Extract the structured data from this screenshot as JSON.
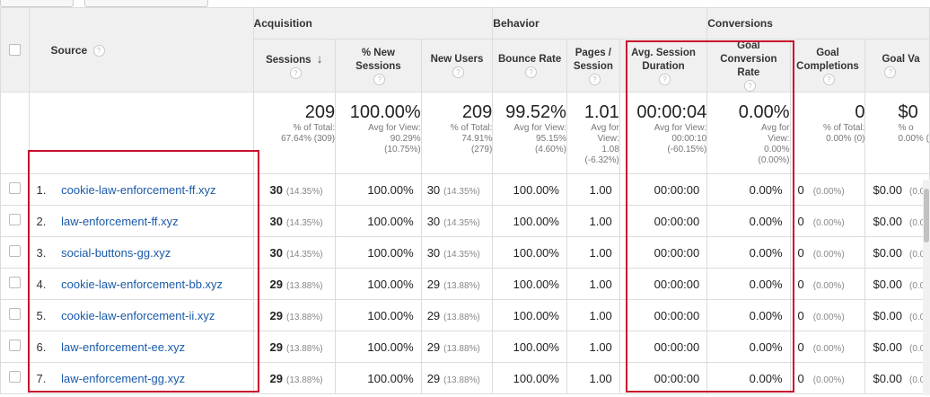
{
  "groups": {
    "acquisition": "Acquisition",
    "behavior": "Behavior",
    "conversions": "Conversions"
  },
  "columns": {
    "source": "Source",
    "sessions": "Sessions",
    "new_sessions": "% New Sessions",
    "new_users": "New Users",
    "bounce_rate": "Bounce Rate",
    "pages_session": "Pages / Session",
    "avg_duration": "Avg. Session Duration",
    "goal_conv_rate": "Goal Conversion Rate",
    "goal_completions": "Goal Completions",
    "goal_value": "Goal Va"
  },
  "totals": {
    "sessions": {
      "value": "209",
      "sub1": "% of Total:",
      "sub2": "67.64% (309)"
    },
    "new_sessions": {
      "value": "100.00%",
      "sub1": "Avg for View:",
      "sub2": "90.29%",
      "sub3": "(10.75%)"
    },
    "new_users": {
      "value": "209",
      "sub1": "% of Total:",
      "sub2": "74.91%",
      "sub3": "(279)"
    },
    "bounce_rate": {
      "value": "99.52%",
      "sub1": "Avg for View:",
      "sub2": "95.15%",
      "sub3": "(4.60%)"
    },
    "pages_session": {
      "value": "1.01",
      "sub1": "Avg for",
      "sub2": "View:",
      "sub3": "1.08",
      "sub4": "(-6.32%)"
    },
    "avg_duration": {
      "value": "00:00:04",
      "sub1": "Avg for View:",
      "sub2": "00:00:10",
      "sub3": "(-60.15%)"
    },
    "goal_conv_rate": {
      "value": "0.00%",
      "sub1": "Avg for",
      "sub2": "View:",
      "sub3": "0.00%",
      "sub4": "(0.00%)"
    },
    "goal_completions": {
      "value": "0",
      "sub1": "% of Total:",
      "sub2": "0.00% (0)"
    },
    "goal_value": {
      "value": "$0",
      "sub1": "% o",
      "sub2": "0.00% ("
    }
  },
  "rows": [
    {
      "idx": "1.",
      "source": "cookie-law-enforcement-ff.xyz",
      "sessions": "30",
      "sessions_pct": "(14.35%)",
      "new_sessions": "100.00%",
      "new_users": "30",
      "new_users_pct": "(14.35%)",
      "bounce": "100.00%",
      "pages": "1.00",
      "duration": "00:00:00",
      "conv": "0.00%",
      "completions": "0",
      "completions_pct": "(0.00%)",
      "value": "$0.00",
      "value_pct": "(0.0"
    },
    {
      "idx": "2.",
      "source": "law-enforcement-ff.xyz",
      "sessions": "30",
      "sessions_pct": "(14.35%)",
      "new_sessions": "100.00%",
      "new_users": "30",
      "new_users_pct": "(14.35%)",
      "bounce": "100.00%",
      "pages": "1.00",
      "duration": "00:00:00",
      "conv": "0.00%",
      "completions": "0",
      "completions_pct": "(0.00%)",
      "value": "$0.00",
      "value_pct": "(0.0"
    },
    {
      "idx": "3.",
      "source": "social-buttons-gg.xyz",
      "sessions": "30",
      "sessions_pct": "(14.35%)",
      "new_sessions": "100.00%",
      "new_users": "30",
      "new_users_pct": "(14.35%)",
      "bounce": "100.00%",
      "pages": "1.00",
      "duration": "00:00:00",
      "conv": "0.00%",
      "completions": "0",
      "completions_pct": "(0.00%)",
      "value": "$0.00",
      "value_pct": "(0.0"
    },
    {
      "idx": "4.",
      "source": "cookie-law-enforcement-bb.xyz",
      "sessions": "29",
      "sessions_pct": "(13.88%)",
      "new_sessions": "100.00%",
      "new_users": "29",
      "new_users_pct": "(13.88%)",
      "bounce": "100.00%",
      "pages": "1.00",
      "duration": "00:00:00",
      "conv": "0.00%",
      "completions": "0",
      "completions_pct": "(0.00%)",
      "value": "$0.00",
      "value_pct": "(0.0"
    },
    {
      "idx": "5.",
      "source": "cookie-law-enforcement-ii.xyz",
      "sessions": "29",
      "sessions_pct": "(13.88%)",
      "new_sessions": "100.00%",
      "new_users": "29",
      "new_users_pct": "(13.88%)",
      "bounce": "100.00%",
      "pages": "1.00",
      "duration": "00:00:00",
      "conv": "0.00%",
      "completions": "0",
      "completions_pct": "(0.00%)",
      "value": "$0.00",
      "value_pct": "(0.0"
    },
    {
      "idx": "6.",
      "source": "law-enforcement-ee.xyz",
      "sessions": "29",
      "sessions_pct": "(13.88%)",
      "new_sessions": "100.00%",
      "new_users": "29",
      "new_users_pct": "(13.88%)",
      "bounce": "100.00%",
      "pages": "1.00",
      "duration": "00:00:00",
      "conv": "0.00%",
      "completions": "0",
      "completions_pct": "(0.00%)",
      "value": "$0.00",
      "value_pct": "(0.0"
    },
    {
      "idx": "7.",
      "source": "law-enforcement-gg.xyz",
      "sessions": "29",
      "sessions_pct": "(13.88%)",
      "new_sessions": "100.00%",
      "new_users": "29",
      "new_users_pct": "(13.88%)",
      "bounce": "100.00%",
      "pages": "1.00",
      "duration": "00:00:00",
      "conv": "0.00%",
      "completions": "0",
      "completions_pct": "(0.00%)",
      "value": "$0.00",
      "value_pct": "(0.0"
    }
  ],
  "colors": {
    "highlight": "#c8102e",
    "link": "#1a5aa8",
    "header_bg": "#f0f0f0"
  },
  "icons": {
    "help": "question-circle-icon",
    "sort": "arrow-down-icon"
  }
}
